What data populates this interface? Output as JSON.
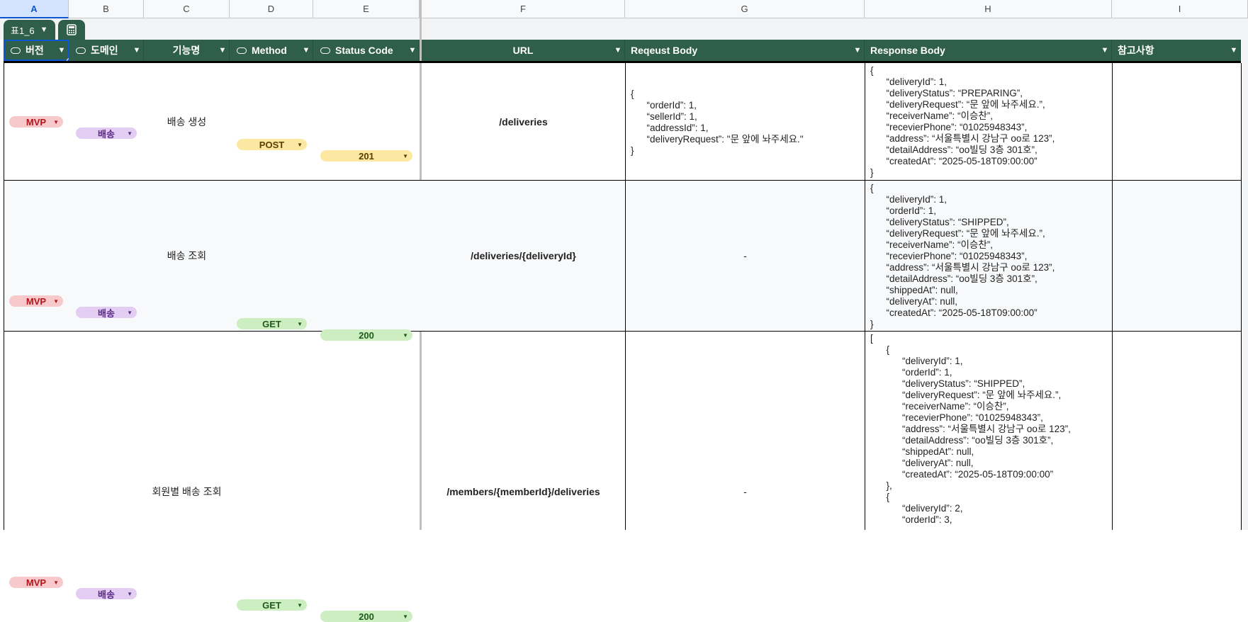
{
  "columns": [
    "A",
    "B",
    "C",
    "D",
    "E",
    "F",
    "G",
    "H",
    "I"
  ],
  "sheet_tab": {
    "label": "표1_6",
    "chevron": "⌄"
  },
  "headers": {
    "version": "버전",
    "domain": "도메인",
    "feature": "기능명",
    "method": "Method",
    "status": "Status Code",
    "url": "URL",
    "request": "Reqeust Body",
    "response": "Response Body",
    "notes": "참고사항"
  },
  "rows": [
    {
      "version": "MVP",
      "domain": "배송",
      "feature": "배송 생성",
      "method": "POST",
      "status": "201",
      "url": "/deliveries",
      "request": "{\n      “orderId”: 1,\n      “sellerId”: 1,\n      “addressId”: 1,\n      “deliveryRequest”: \"문 앞에 놔주세요.\"\n}",
      "response": "{\n      “deliveryId”: 1,\n      “deliveryStatus”: “PREPARING”,\n      “deliveryRequest”: “문 앞에 놔주세요.”,\n      “receiverName”: “이승찬”,\n      “recevierPhone”: “01025948343”,\n      “address”: “서울특별시 강남구 oo로 123”,\n      “detailAddress”: “oo빌딩 3층 301호”,\n      “createdAt”: “2025-05-18T09:00:00”\n}",
      "notes": ""
    },
    {
      "version": "MVP",
      "domain": "배송",
      "feature": "배송 조회",
      "method": "GET",
      "status": "200",
      "url": "/deliveries/{deliveryId}",
      "request": "-",
      "response": "{\n      “deliveryId”: 1,\n      “orderId”: 1,\n      “deliveryStatus”: “SHIPPED”,\n      “deliveryRequest”: “문 앞에 놔주세요.”,\n      “receiverName”: “이승찬”,\n      “recevierPhone”: “01025948343”,\n      “address”: “서울특별시 강남구 oo로 123”,\n      “detailAddress”: “oo빌딩 3층 301호”,\n      “shippedAt”: null,\n      “deliveryAt”: null,\n      “createdAt”: “2025-05-18T09:00:00”\n}",
      "notes": ""
    },
    {
      "version": "MVP",
      "domain": "배송",
      "feature": "회원별 배송 조회",
      "method": "GET",
      "status": "200",
      "url": "/members/{memberId}/deliveries",
      "request": "-",
      "response": "[\n      {\n            “deliveryId”: 1,\n            “orderId”: 1,\n            “deliveryStatus”: “SHIPPED”,\n            “deliveryRequest”: “문 앞에 놔주세요.”,\n            “receiverName”: “이승찬”,\n            “recevierPhone”: “01025948343”,\n            “address”: “서울특별시 강남구 oo로 123”,\n            “detailAddress”: “oo빌딩 3층 301호”,\n            “shippedAt”: null,\n            “deliveryAt”: null,\n            “createdAt”: “2025-05-18T09:00:00”\n      },\n      {\n            “deliveryId”: 2,\n            “orderId”: 3,",
      "notes": ""
    }
  ],
  "colors": {
    "header_bg": "#2f5f4a",
    "mvp": "#f7c9cb",
    "domain": "#e3cdf2",
    "post": "#fde8a3",
    "get": "#cdeec1"
  }
}
